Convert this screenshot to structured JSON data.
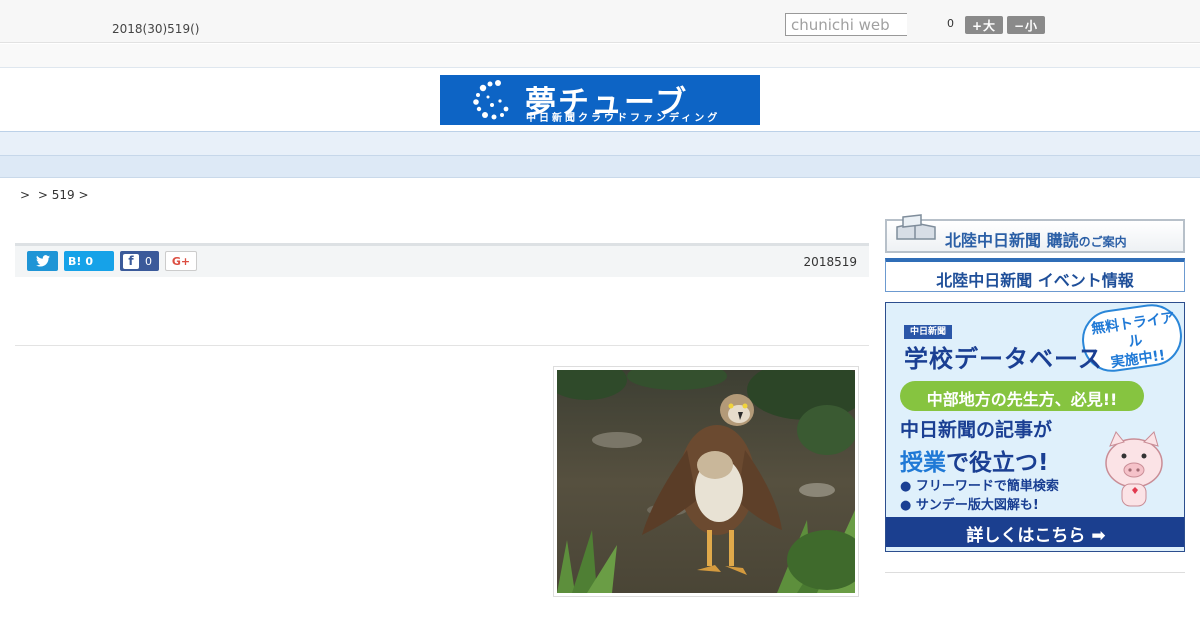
{
  "header": {
    "date": "2018(30)519()",
    "search_placeholder": "chunichi web",
    "font_size_label": "0",
    "font_bigger": "+大",
    "font_smaller": "−小"
  },
  "logo": {
    "title": "夢チューブ",
    "subtitle": "中日新聞クラウドファンディング"
  },
  "nav": {
    "items": [
      "",
      "",
      "",
      "",
      "",
      "",
      "",
      "",
      ""
    ]
  },
  "breadcrumb": [
    ">",
    "> 519 >"
  ],
  "article": {
    "share": {
      "hatena_label": "B!",
      "hatena_count": "0",
      "facebook_count": "0",
      "google_label": "G+"
    },
    "date": "2018519"
  },
  "sidebar": {
    "subscribe": {
      "title": "北陸中日新聞 購読",
      "suffix": "のご案内"
    },
    "event": {
      "title": "北陸中日新聞 イベント情報"
    },
    "ad": {
      "brand": "中日新聞",
      "title": "学校データベース",
      "trial_line1": "無料トライアル",
      "trial_line2": "実施中!!",
      "green": "中部地方の先生方、必見!!",
      "line1": "中日新聞の記事が",
      "line2_em": "授業",
      "line2_rest": "で役立つ!",
      "bullet1": "● フリーワードで簡単検索",
      "bullet2": "● サンデー版大図解も!",
      "cta": "詳しくはこちら ➡"
    }
  },
  "colors": {
    "brand_blue": "#0d64c5",
    "nav_bg": "#e8f0f9",
    "twitter": "#1f95d6",
    "hatena": "#16a2e8",
    "facebook": "#3b5a9a",
    "google": "#dc4e41"
  }
}
